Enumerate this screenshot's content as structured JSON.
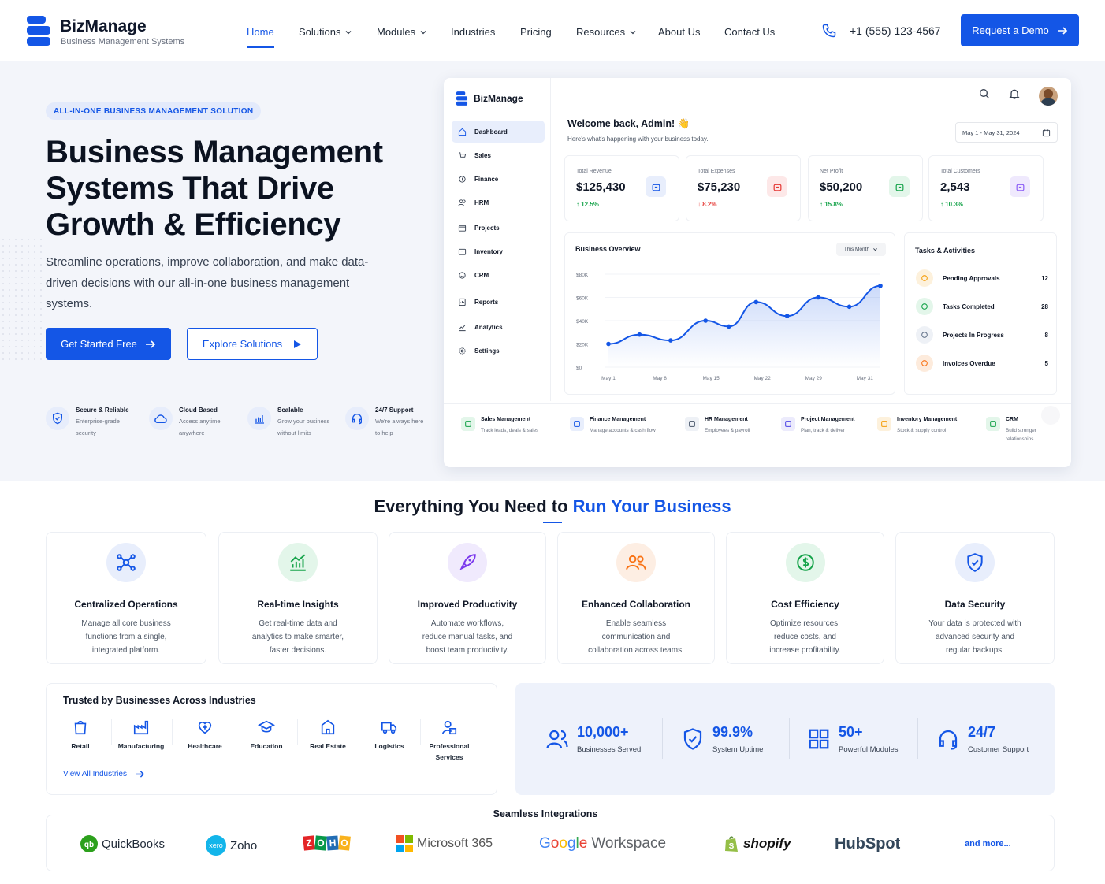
{
  "header": {
    "brand": "BizManage",
    "brand_sub": "Business Management Systems",
    "nav": [
      "Home",
      "Solutions",
      "Modules",
      "Industries",
      "Pricing",
      "Resources",
      "About Us",
      "Contact Us"
    ],
    "phone": "+1 (555) 123-4567",
    "cta": "Request a Demo"
  },
  "hero": {
    "badge": "ALL-IN-ONE BUSINESS MANAGEMENT SOLUTION",
    "title_line1": "Business Management",
    "title_line2": "Systems That Drive",
    "title_line3": "Growth & Efficiency",
    "lead": "Streamline operations, improve collaboration, and make data-driven decisions with our all-in-one business management systems.",
    "primary_btn": "Get Started Free",
    "secondary_btn": "Explore Solutions",
    "features": [
      {
        "title": "Secure & Reliable",
        "desc1": "Enterprise-grade",
        "desc2": "security",
        "icon": "shield-icon"
      },
      {
        "title": "Cloud Based",
        "desc1": "Access anytime,",
        "desc2": "anywhere",
        "icon": "cloud-icon"
      },
      {
        "title": "Scalable",
        "desc1": "Grow your business",
        "desc2": "without limits",
        "icon": "chart-icon"
      },
      {
        "title": "24/7 Support",
        "desc1": "We're always here",
        "desc2": "to help",
        "icon": "headset-icon"
      }
    ]
  },
  "dashboard": {
    "brand": "BizManage",
    "sidebar": [
      "Dashboard",
      "Sales",
      "Finance",
      "HRM",
      "Projects",
      "Inventory",
      "CRM",
      "Reports",
      "Analytics",
      "Settings"
    ],
    "welcome": "Welcome back, Admin! 👋",
    "welcome_sub": "Here's what's happening with your business today.",
    "date_range": "May 1 - May 31, 2024",
    "kpis": [
      {
        "label": "Total Revenue",
        "value": "$125,430",
        "change": "↑ 12.5%",
        "dir": "up",
        "color": "#1456e6",
        "bg": "#e8eefc"
      },
      {
        "label": "Total Expenses",
        "value": "$75,230",
        "change": "↓ 8.2%",
        "dir": "down",
        "color": "#e53935",
        "bg": "#fde8e8"
      },
      {
        "label": "Net Profit",
        "value": "$50,200",
        "change": "↑ 15.8%",
        "dir": "up",
        "color": "#16a34a",
        "bg": "#e3f6ea"
      },
      {
        "label": "Total Customers",
        "value": "2,543",
        "change": "↑ 10.3%",
        "dir": "up",
        "color": "#8b5cf6",
        "bg": "#efe9fd"
      }
    ],
    "overview_title": "Business Overview",
    "overview_filter": "This Month",
    "tasks_title": "Tasks & Activities",
    "tasks": [
      {
        "label": "Pending Approvals",
        "count": "12",
        "color": "#f59e0b",
        "bg": "#fdf1dc"
      },
      {
        "label": "Tasks Completed",
        "count": "28",
        "color": "#16a34a",
        "bg": "#e3f6ea"
      },
      {
        "label": "Projects In Progress",
        "count": "8",
        "color": "#64748b",
        "bg": "#eef1f6"
      },
      {
        "label": "Invoices Overdue",
        "count": "5",
        "color": "#f97316",
        "bg": "#fdebdc"
      }
    ],
    "modules": [
      {
        "title": "Sales Management",
        "desc1": "Track leads, deals & sales",
        "desc2": "",
        "color": "#16a34a",
        "bg": "#e3f6ea"
      },
      {
        "title": "Finance Management",
        "desc1": "Manage accounts & cash flow",
        "desc2": "",
        "color": "#1456e6",
        "bg": "#e8eefc"
      },
      {
        "title": "HR Management",
        "desc1": "Employees & payroll",
        "desc2": "",
        "color": "#475569",
        "bg": "#eef1f6"
      },
      {
        "title": "Project Management",
        "desc1": "Plan, track & deliver",
        "desc2": "",
        "color": "#4f46e5",
        "bg": "#ecebfc"
      },
      {
        "title": "Inventory Management",
        "desc1": "Stock & supply control",
        "desc2": "",
        "color": "#f59e0b",
        "bg": "#fdf1dc"
      },
      {
        "title": "CRM",
        "desc1": "Build stronger",
        "desc2": "relationships",
        "color": "#16a34a",
        "bg": "#e3f6ea"
      }
    ]
  },
  "chart_data": {
    "type": "line",
    "title": "Business Overview",
    "x_ticks": [
      "May 1",
      "May 8",
      "May 15",
      "May 22",
      "May 29",
      "May 31"
    ],
    "y_ticks": [
      "$0",
      "$20K",
      "$40K",
      "$60K",
      "$80K"
    ],
    "ylim": [
      0,
      80000
    ],
    "series": [
      {
        "values": [
          20000,
          28000,
          23000,
          40000,
          35000,
          56000,
          44000,
          60000,
          52000,
          70000
        ]
      }
    ],
    "x_positions": [
      0,
      4,
      8,
      12.5,
      15.5,
      19,
      23,
      27,
      31,
      35
    ]
  },
  "features_section": {
    "title_a": "Everything You Need to ",
    "title_b": "Run Your Business",
    "cards": [
      {
        "title": "Centralized Operations",
        "d1": "Manage all core business",
        "d2": "functions from a single,",
        "d3": "integrated platform.",
        "color": "#1456e6",
        "bg": "#e8eefc"
      },
      {
        "title": "Real-time Insights",
        "d1": "Get real-time data and",
        "d2": "analytics to make smarter,",
        "d3": "faster decisions.",
        "color": "#16a34a",
        "bg": "#e3f6ea"
      },
      {
        "title": "Improved Productivity",
        "d1": "Automate workflows,",
        "d2": "reduce manual tasks, and",
        "d3": "boost team productivity.",
        "color": "#7c3aed",
        "bg": "#f0eafd"
      },
      {
        "title": "Enhanced Collaboration",
        "d1": "Enable seamless",
        "d2": "communication and",
        "d3": "collaboration across teams.",
        "color": "#f97316",
        "bg": "#fdeee3"
      },
      {
        "title": "Cost Efficiency",
        "d1": "Optimize resources,",
        "d2": "reduce costs, and",
        "d3": "increase profitability.",
        "color": "#16a34a",
        "bg": "#e3f6ea"
      },
      {
        "title": "Data Security",
        "d1": "Your data is protected with",
        "d2": "advanced security and",
        "d3": "regular backups.",
        "color": "#1456e6",
        "bg": "#e8eefc"
      }
    ]
  },
  "trusted": {
    "title": "Trusted by Businesses Across Industries",
    "industries": [
      {
        "l1": "Retail",
        "l2": ""
      },
      {
        "l1": "Manufacturing",
        "l2": ""
      },
      {
        "l1": "Healthcare",
        "l2": ""
      },
      {
        "l1": "Education",
        "l2": ""
      },
      {
        "l1": "Real Estate",
        "l2": ""
      },
      {
        "l1": "Logistics",
        "l2": ""
      },
      {
        "l1": "Professional",
        "l2": "Services"
      }
    ],
    "link": "View All Industries"
  },
  "stats": [
    {
      "value": "10,000+",
      "label": "Businesses Served"
    },
    {
      "value": "99.9%",
      "label": "System Uptime"
    },
    {
      "value": "50+",
      "label": "Powerful Modules"
    },
    {
      "value": "24/7",
      "label": "Customer Support"
    }
  ],
  "integrations": {
    "title": "Seamless Integrations",
    "logos": [
      "QuickBooks",
      "xero",
      "Zoho",
      "ZOHO",
      "Microsoft 365",
      "Google",
      "Workspace",
      "shopify",
      "HubSpot"
    ],
    "more": "and more..."
  },
  "colors": {
    "accent": "#1456e6",
    "hero_bg": "#f3f5fa"
  }
}
